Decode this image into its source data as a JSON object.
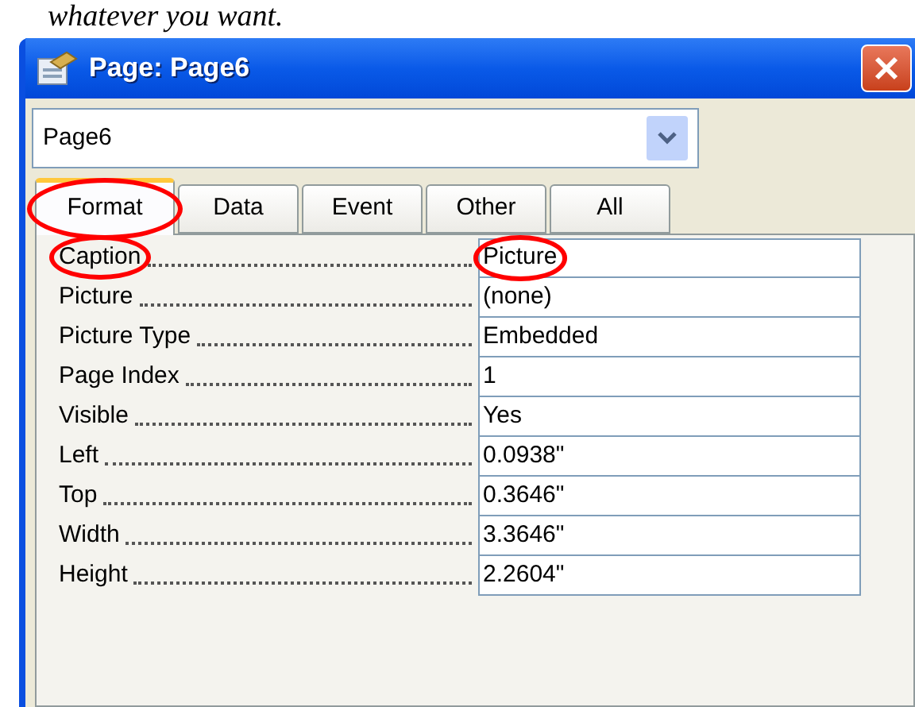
{
  "caption_above": "whatever you want.",
  "window": {
    "title": "Page: Page6"
  },
  "object_select": {
    "value": "Page6"
  },
  "tabs": [
    {
      "label": "Format",
      "selected": true,
      "circled": true
    },
    {
      "label": "Data",
      "selected": false,
      "circled": false
    },
    {
      "label": "Event",
      "selected": false,
      "circled": false
    },
    {
      "label": "Other",
      "selected": false,
      "circled": false
    },
    {
      "label": "All",
      "selected": false,
      "circled": false
    }
  ],
  "properties": [
    {
      "name": "Caption",
      "value": "Picture",
      "name_circled": true,
      "value_circled": true
    },
    {
      "name": "Picture",
      "value": "(none)",
      "name_circled": false,
      "value_circled": false
    },
    {
      "name": "Picture Type",
      "value": "Embedded",
      "name_circled": false,
      "value_circled": false
    },
    {
      "name": "Page Index",
      "value": "1",
      "name_circled": false,
      "value_circled": false
    },
    {
      "name": "Visible",
      "value": "Yes",
      "name_circled": false,
      "value_circled": false
    },
    {
      "name": "Left",
      "value": "0.0938\"",
      "name_circled": false,
      "value_circled": false
    },
    {
      "name": "Top",
      "value": "0.3646\"",
      "name_circled": false,
      "value_circled": false
    },
    {
      "name": "Width",
      "value": "3.3646\"",
      "name_circled": false,
      "value_circled": false
    },
    {
      "name": "Height",
      "value": "2.2604\"",
      "name_circled": false,
      "value_circled": false
    }
  ]
}
